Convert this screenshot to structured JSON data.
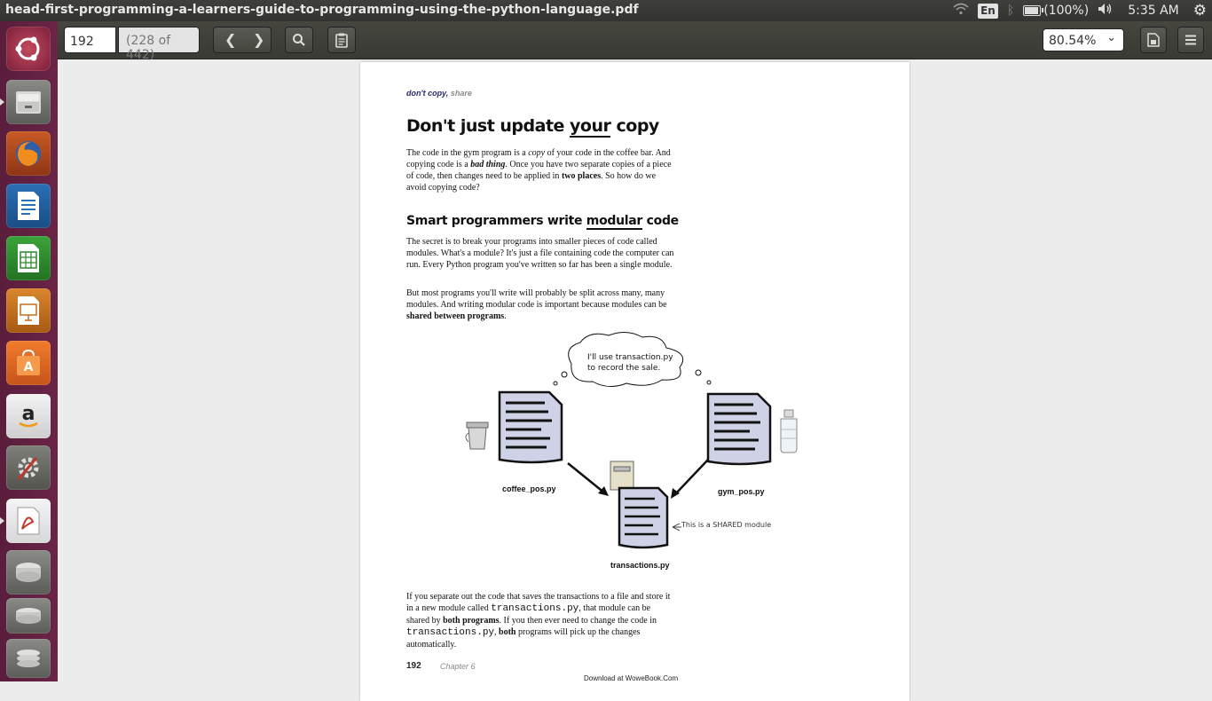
{
  "window": {
    "title": "head-first-programming-a-learners-guide-to-programming-using-the-python-language.pdf"
  },
  "tray": {
    "lang": "En",
    "battery": "(100%)",
    "time": "5:35 AM",
    "battery_level": 1.0
  },
  "launcher": {
    "items": [
      "ubuntu-dash",
      "files",
      "firefox",
      "libreoffice-writer",
      "libreoffice-calc",
      "libreoffice-impress",
      "ubuntu-software",
      "amazon",
      "system-settings",
      "document-viewer",
      "drive-1",
      "drive-2",
      "trash"
    ]
  },
  "toolbar": {
    "page": "192",
    "page_count": "(228 of 442)",
    "zoom": "80.54%"
  },
  "document": {
    "header_a": "don't copy,",
    "header_b": "share",
    "h1_pre": "Don't just update ",
    "h1_u": "your",
    "h1_post": " copy",
    "p1_a": "The code in the gym program is a ",
    "p1_i": "copy",
    "p1_b": " of your code in the coffee bar. And copying code is a ",
    "p1_bi": "bad thing",
    "p1_c": ". Once you have two separate copies of a piece of code, then changes need to be applied in ",
    "p1_bold": "two places",
    "p1_d": ". So how do we avoid copying code?",
    "h2_pre": "Smart programmers write ",
    "h2_u": "modular",
    "h2_post": " code",
    "p2": "The secret is to break your programs into smaller pieces of code called modules. What's a module? It's just a file containing code the computer can run. Every Python program you've written so far has been a single module.",
    "p3_a": "But most programs you'll write will probably be split across many, many modules. And writing modular code is important because modules can be ",
    "p3_bold": "shared between programs",
    "p3_b": ".",
    "bubble_l1": "I'll use transaction.py",
    "bubble_l2": "to record the sale.",
    "label_coffee": "coffee_pos.py",
    "label_gym": "gym_pos.py",
    "label_trans": "transactions.py",
    "shared_note": "This is a SHARED module",
    "p4_a": "If you separate out the code that saves the transactions to a file and store it in a new module called ",
    "p4_m1": "transactions.py",
    "p4_b": ", that module can be shared by ",
    "p4_bold1": "both programs",
    "p4_c": ". If you then ever need to change the code in ",
    "p4_m2": "transactions.py",
    "p4_d": ", ",
    "p4_bold2": "both",
    "p4_e": " programs will pick up the changes automatically.",
    "page_num": "192",
    "chapter": "Chapter 6",
    "download": "Download at WoweBook.Com"
  }
}
